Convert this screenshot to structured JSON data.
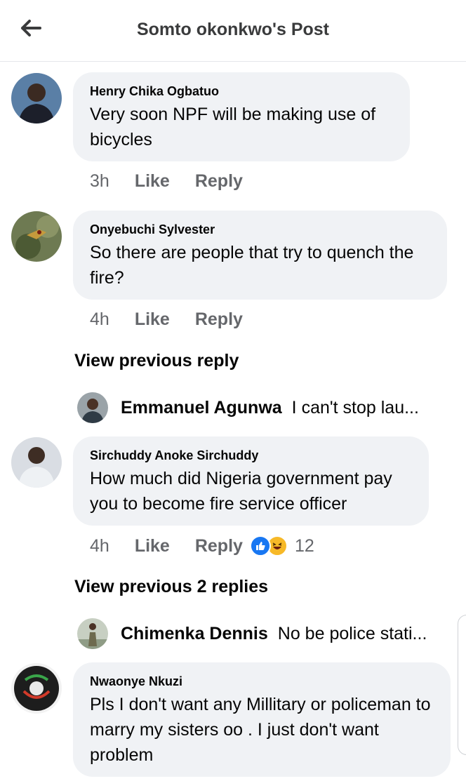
{
  "header": {
    "title": "Somto okonkwo's Post",
    "back_icon": "arrow-left-icon"
  },
  "comments": [
    {
      "author": "Henry Chika Ogbatuo",
      "text": "Very soon NPF will be making use of bicycles",
      "time": "3h",
      "like": "Like",
      "reply": "Reply"
    },
    {
      "author": "Onyebuchi Sylvester",
      "text": "So there are people that try to quench the fire?",
      "time": "4h",
      "like": "Like",
      "reply": "Reply"
    },
    {
      "author": "Sirchuddy Anoke Sirchuddy",
      "text": "How much did Nigeria government pay you to become fire service officer",
      "time": "4h",
      "like": "Like",
      "reply": "Reply",
      "reaction_count": "12",
      "reactions": [
        "like",
        "haha"
      ]
    },
    {
      "author": "Nwaonye Nkuzi",
      "text": "Pls I don't want any Millitary or policeman to marry my sisters oo . I just don't want problem"
    }
  ],
  "view_previous": [
    "View previous reply",
    "View previous 2 replies"
  ],
  "replies": [
    {
      "author": "Emmanuel Agunwa",
      "text": "I can't stop lau..."
    },
    {
      "author": "Chimenka Dennis",
      "text": "No be police stati..."
    }
  ],
  "colors": {
    "bubble": "#f0f2f5",
    "secondary_text": "#65676b",
    "like_blue": "#1877f2",
    "haha_yellow": "#f7b928"
  }
}
